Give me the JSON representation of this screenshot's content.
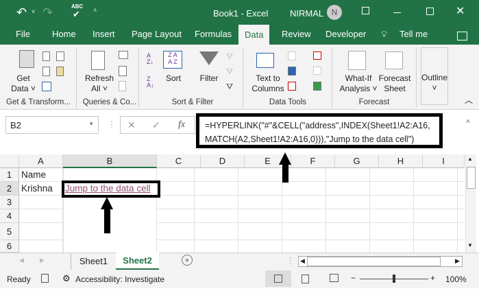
{
  "title_bar": {
    "title": "Book1  -  Excel",
    "user": "NIRMAL",
    "avatar": "N",
    "qat_spell": "ABC"
  },
  "tabs": [
    "File",
    "Home",
    "Insert",
    "Page Layout",
    "Formulas",
    "Data",
    "Review",
    "Developer",
    "Tell me"
  ],
  "ribbon": {
    "get_data": [
      "Get",
      "Data ˅"
    ],
    "refresh": [
      "Refresh",
      "All ˅"
    ],
    "sort": "Sort",
    "filter": "Filter",
    "text_to_columns": [
      "Text to",
      "Columns"
    ],
    "what_if": [
      "What-If",
      "Analysis ˅"
    ],
    "forecast_sheet": [
      "Forecast",
      "Sheet"
    ],
    "outline": "Outline",
    "groups": [
      "Get & Transform...",
      "Queries & Co...",
      "Sort & Filter",
      "Data Tools",
      "Forecast"
    ]
  },
  "formula_bar": {
    "name_box": "B2",
    "fx": "fx",
    "formula_line1": "=HYPERLINK(\"#\"&CELL(\"address\",INDEX(Sheet1!A2:A16,",
    "formula_line2": "MATCH(A2,Sheet1!A2:A16,0))),\"Jump to the data cell\")"
  },
  "columns": [
    "A",
    "B",
    "C",
    "D",
    "E",
    "F",
    "G",
    "H",
    "I"
  ],
  "rows": [
    "1",
    "2",
    "3",
    "4",
    "5",
    "6"
  ],
  "cells": {
    "A1": "Name",
    "A2": "Krishna",
    "B2": "Jump to the data cell"
  },
  "sheets": [
    "Sheet1",
    "Sheet2"
  ],
  "status": {
    "ready": "Ready",
    "accessibility": "Accessibility: Investigate",
    "zoom": "100%"
  },
  "colors": {
    "brand": "#217346",
    "link": "#954f72"
  }
}
